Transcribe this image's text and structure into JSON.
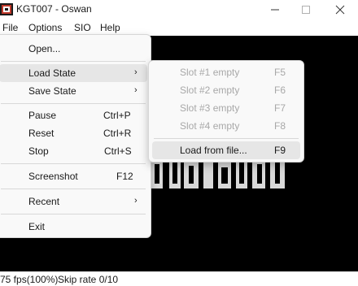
{
  "window": {
    "title": "KGT007 - Oswan",
    "icons": {
      "app": "app-icon",
      "minimize": "minimize-icon",
      "maximize": "maximize-icon",
      "close": "close-icon"
    }
  },
  "menubar": [
    "File",
    "Options",
    "SIO",
    "Help"
  ],
  "file_menu": {
    "items": [
      {
        "label": "Open..."
      },
      {
        "label": "Load State",
        "submenu": true
      },
      {
        "label": "Save State",
        "submenu": true
      },
      {
        "label": "Pause",
        "shortcut": "Ctrl+P"
      },
      {
        "label": "Reset",
        "shortcut": "Ctrl+R"
      },
      {
        "label": "Stop",
        "shortcut": "Ctrl+S"
      },
      {
        "label": "Screenshot",
        "shortcut": "F12"
      },
      {
        "label": "Recent",
        "submenu": true
      },
      {
        "label": "Exit"
      }
    ],
    "highlighted": "Load State"
  },
  "load_state_menu": {
    "items": [
      {
        "label": "Slot #1  empty",
        "shortcut": "F5",
        "enabled": false
      },
      {
        "label": "Slot #2  empty",
        "shortcut": "F6",
        "enabled": false
      },
      {
        "label": "Slot #3  empty",
        "shortcut": "F7",
        "enabled": false
      },
      {
        "label": "Slot #4  empty",
        "shortcut": "F8",
        "enabled": false
      },
      {
        "label": "Load from file...",
        "shortcut": "F9",
        "enabled": true
      }
    ],
    "highlighted": "Load from file..."
  },
  "status": {
    "fps": "75 fps(100%)",
    "skip": "Skip rate 0/10"
  },
  "colors": {
    "screen": "#000000",
    "highlight": "#e6e6e6",
    "disabled_text": "#a8a8a8"
  }
}
